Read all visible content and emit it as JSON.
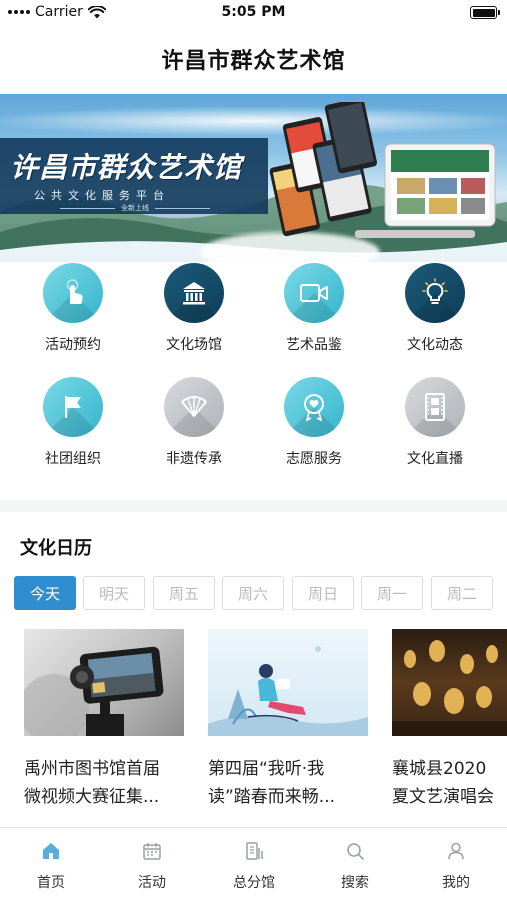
{
  "status_bar": {
    "carrier": "Carrier",
    "time": "5:05 PM"
  },
  "nav": {
    "title": "许昌市群众艺术馆"
  },
  "banner": {
    "title": "许昌市群众艺术馆",
    "subtitle": "公共文化服务平台",
    "tagline": "全新上线"
  },
  "grid": [
    {
      "label": "活动预约",
      "icon": "hand-tap-icon",
      "color": "#3fb9cf"
    },
    {
      "label": "文化场馆",
      "icon": "museum-icon",
      "color": "#14496a"
    },
    {
      "label": "艺术品鉴",
      "icon": "video-camera-icon",
      "color": "#3fb9cf"
    },
    {
      "label": "文化动态",
      "icon": "lightbulb-icon",
      "color": "#14496a"
    },
    {
      "label": "社团组织",
      "icon": "flag-icon",
      "color": "#3fb9cf"
    },
    {
      "label": "非遗传承",
      "icon": "fan-icon",
      "color": "#b9bec3"
    },
    {
      "label": "志愿服务",
      "icon": "heart-badge-icon",
      "color": "#3fb9cf"
    },
    {
      "label": "文化直播",
      "icon": "film-strip-icon",
      "color": "#b9bec3"
    }
  ],
  "calendar": {
    "title": "文化日历",
    "days": [
      "今天",
      "明天",
      "周五",
      "周六",
      "周日",
      "周一",
      "周二"
    ],
    "active_index": 0,
    "accent": "#2f8ecf"
  },
  "events": [
    {
      "title_line1": "禹州市图书馆首届",
      "title_line2": "微视频大赛征集..."
    },
    {
      "title_line1": "第四届“我听·我",
      "title_line2": "读”踏春而来畅..."
    },
    {
      "title_line1": "襄城县2020",
      "title_line2": "夏文艺演唱会"
    }
  ],
  "tabs": [
    {
      "label": "首页",
      "icon": "home-icon",
      "active": true
    },
    {
      "label": "活动",
      "icon": "calendar-icon",
      "active": false
    },
    {
      "label": "总分馆",
      "icon": "library-icon",
      "active": false
    },
    {
      "label": "搜索",
      "icon": "search-icon",
      "active": false
    },
    {
      "label": "我的",
      "icon": "user-icon",
      "active": false
    }
  ],
  "colors": {
    "tab_active": "#3aa0d8",
    "tab_inactive": "#9aa0a6"
  }
}
